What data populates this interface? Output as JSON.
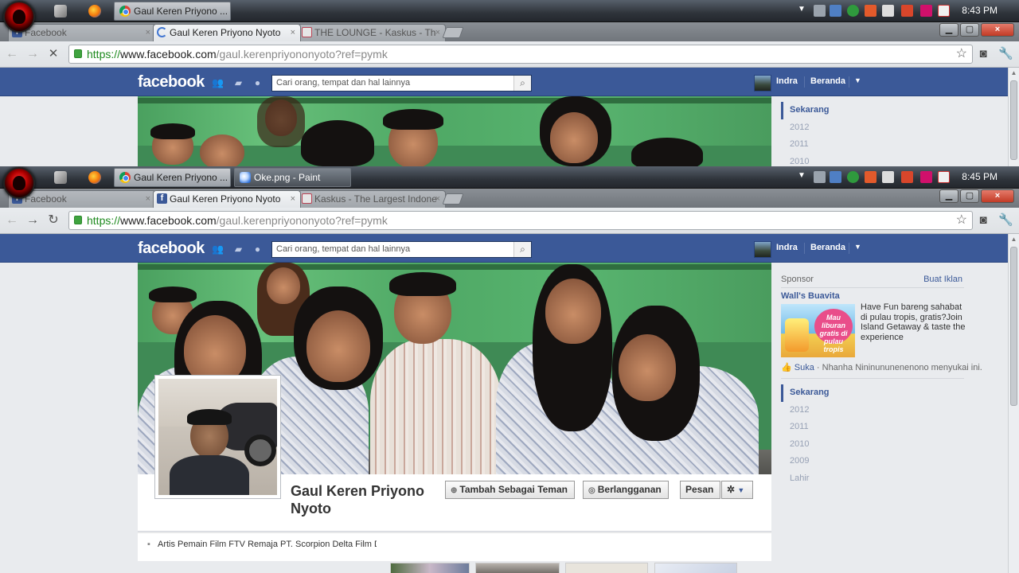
{
  "screens": [
    {
      "taskbar": {
        "windows": [
          {
            "label": "Gaul Keren Priyono ...",
            "icon": "chrome-icon",
            "active": true
          }
        ],
        "clock": "8:43 PM"
      },
      "browser": {
        "tabs": [
          {
            "label": "Facebook",
            "favicon": "facebook-icon",
            "active": false
          },
          {
            "label": "Gaul Keren Priyono Nyoto",
            "favicon": "loading-spinner-icon",
            "active": true
          },
          {
            "label": "THE LOUNGE - Kaskus - Th",
            "favicon": "kaskus-icon",
            "active": false
          }
        ],
        "url": {
          "scheme": "https://",
          "host": "www.facebook.com",
          "path": "/gaul.kerenpriyononyoto?ref=pymk"
        },
        "reload_state": "stop"
      },
      "facebook": {
        "logo": "facebook",
        "search_placeholder": "Cari orang, tempat dan hal lainnya",
        "user": "Indra",
        "home": "Beranda",
        "timeline": [
          "Sekarang",
          "2012",
          "2011",
          "2010"
        ]
      }
    },
    {
      "taskbar": {
        "windows": [
          {
            "label": "Gaul Keren Priyono ...",
            "icon": "chrome-icon",
            "active": true
          },
          {
            "label": "Oke.png - Paint",
            "icon": "paint-icon",
            "active": false
          }
        ],
        "clock": "8:45 PM"
      },
      "browser": {
        "tabs": [
          {
            "label": "Facebook",
            "favicon": "facebook-icon",
            "active": false
          },
          {
            "label": "Gaul Keren Priyono Nyoto",
            "favicon": "facebook-icon",
            "active": true
          },
          {
            "label": "Kaskus - The Largest Indone",
            "favicon": "kaskus-icon",
            "active": false
          }
        ],
        "url": {
          "scheme": "https://",
          "host": "www.facebook.com",
          "path": "/gaul.kerenpriyononyoto?ref=pymk"
        },
        "reload_state": "reload"
      },
      "facebook": {
        "logo": "facebook",
        "search_placeholder": "Cari orang, tempat dan hal lainnya",
        "user": "Indra",
        "home": "Beranda",
        "profile_name": "Gaul Keren Priyono Nyoto",
        "buttons": {
          "add_friend": "Tambah Sebagai Teman",
          "subscribe": "Berlangganan",
          "message": "Pesan"
        },
        "info": "Artis Pemain Film FTV Remaja PT. Scorpion Delta Film Di...",
        "ad": {
          "sponsor": "Sponsor",
          "create_ad": "Buat Iklan",
          "title": "Wall's Buavita",
          "image_text": "Mau liburan gratis di pulau tropis",
          "body": "Have Fun bareng sahabat di pulau tropis, gratis?Join Island Getaway & taste the experience",
          "like": "Suka",
          "likers": "· Nhanha Nininununenenono menyukai ini."
        },
        "timeline": [
          "Sekarang",
          "2012",
          "2011",
          "2010",
          "2009",
          "Lahir"
        ]
      }
    }
  ],
  "colors": {
    "facebook_blue": "#3b5998",
    "taskbar": "#2f343b",
    "page_bg": "#e9ebee"
  }
}
